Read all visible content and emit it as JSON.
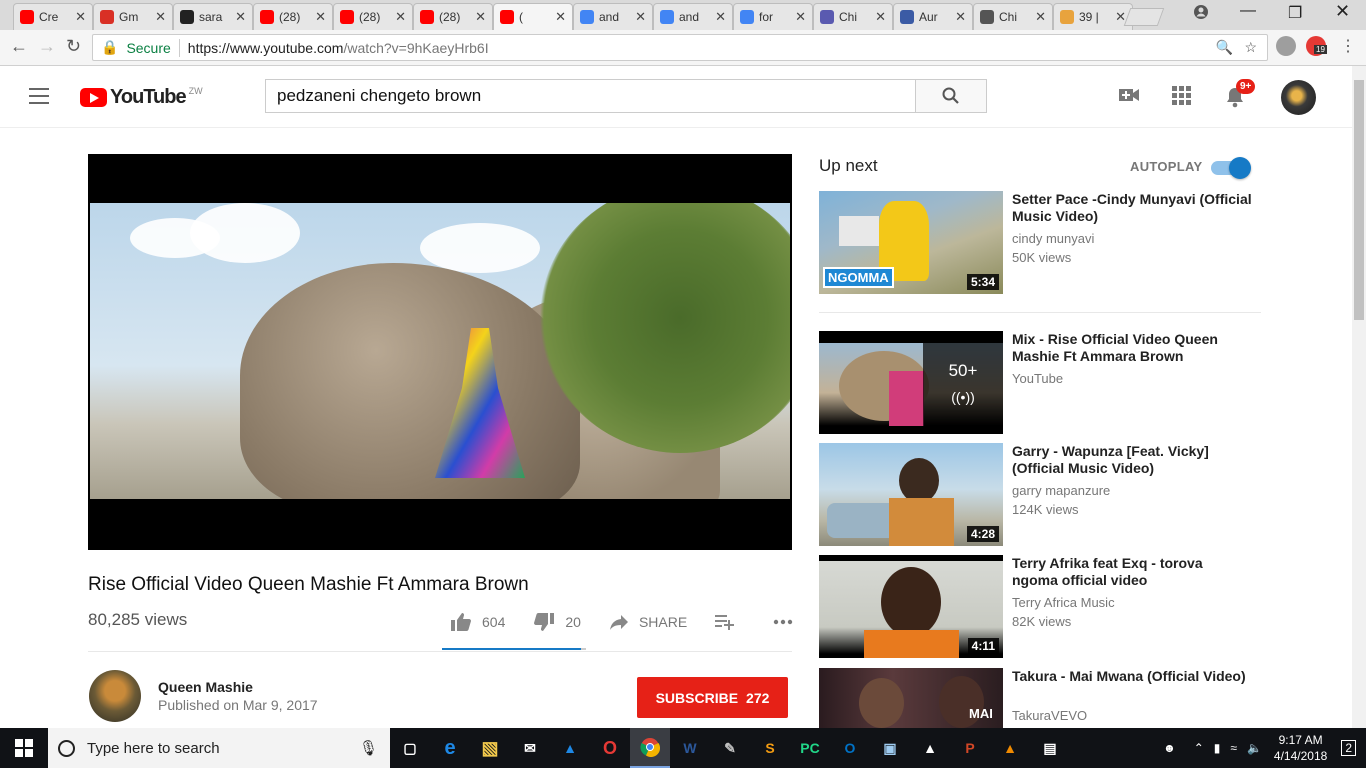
{
  "browser": {
    "tabs": [
      {
        "label": "Cre",
        "icon": "youtube-icon",
        "color": "#ff0000"
      },
      {
        "label": "Gm",
        "icon": "gmail-icon",
        "color": "#d93025"
      },
      {
        "label": "sara",
        "icon": "github-icon",
        "color": "#222222"
      },
      {
        "label": "(28)",
        "icon": "youtube-icon",
        "color": "#ff0000"
      },
      {
        "label": "(28)",
        "icon": "youtube-icon",
        "color": "#ff0000"
      },
      {
        "label": "(28)",
        "icon": "youtube-icon",
        "color": "#ff0000"
      },
      {
        "label": "(",
        "icon": "youtube-icon",
        "color": "#ff0000"
      },
      {
        "label": "and",
        "icon": "google-icon",
        "color": "#4285f4"
      },
      {
        "label": "and",
        "icon": "google-icon",
        "color": "#4285f4"
      },
      {
        "label": "for",
        "icon": "google-icon",
        "color": "#4285f4"
      },
      {
        "label": "Chi",
        "icon": "site-icon",
        "color": "#5a5ab0"
      },
      {
        "label": "Aur",
        "icon": "s-icon",
        "color": "#3b5ba5"
      },
      {
        "label": "Chi",
        "icon": "wikipedia-icon",
        "color": "#555555"
      },
      {
        "label": "39 |",
        "icon": "her-icon",
        "color": "#e8a33d"
      }
    ],
    "secure_label": "Secure",
    "url_host": "https://www.youtube.com",
    "url_path": "/watch?v=9hKaeyHrb6I",
    "extension_badge": "19"
  },
  "header": {
    "logo_text": "YouTube",
    "country_code": "ZW",
    "search_value": "pedzaneni chengeto brown",
    "notification_count": "9+"
  },
  "video": {
    "title": "Rise Official Video Queen Mashie Ft Ammara Brown",
    "views": "80,285 views",
    "likes": "604",
    "dislikes": "20",
    "share_label": "SHARE",
    "like_ratio": 0.968,
    "channel": "Queen Mashie",
    "published": "Published on Mar 9, 2017",
    "subscribe_label": "SUBSCRIBE",
    "subscriber_count": "272"
  },
  "sidebar": {
    "up_next_label": "Up next",
    "autoplay_label": "AUTOPLAY",
    "autoplay_on": true,
    "items": [
      {
        "title": "Setter Pace -Cindy Munyavi (Official Music Video)",
        "channel": "cindy munyavi",
        "views": "50K views",
        "duration": "5:34",
        "overlay": "NGOMMA"
      },
      {
        "title": "Mix - Rise Official Video Queen Mashie Ft Ammara Brown",
        "channel": "YouTube",
        "views": "",
        "mix_count": "50+"
      },
      {
        "title": "Garry - Wapunza [Feat. Vicky] (Official Music Video)",
        "channel": "garry mapanzure",
        "views": "124K views",
        "duration": "4:28"
      },
      {
        "title": "Terry Afrika feat Exq - torova ngoma official video",
        "channel": "Terry Africa Music",
        "views": "82K views",
        "duration": "4:11"
      },
      {
        "title": "Takura - Mai Mwana (Official Video)",
        "channel": "TakuraVEVO",
        "views": "",
        "overlay": "MAI"
      }
    ]
  },
  "taskbar": {
    "search_placeholder": "Type here to search",
    "time": "9:17 AM",
    "date": "4/14/2018",
    "notifications": "2"
  }
}
